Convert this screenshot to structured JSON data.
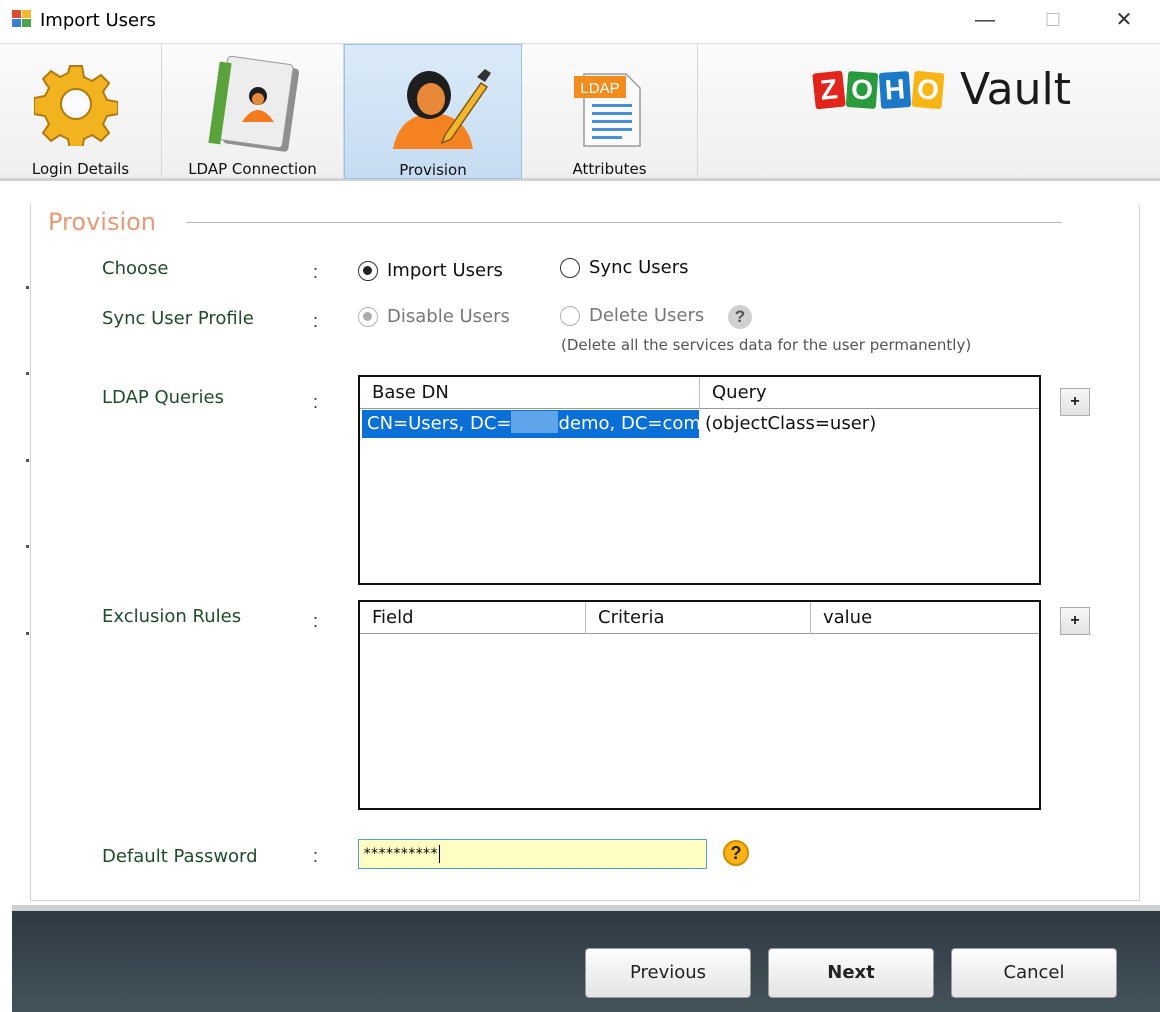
{
  "window": {
    "title": "Import Users",
    "minimize_glyph": "—",
    "maximize_glyph": "☐",
    "close_glyph": "✕"
  },
  "tabs": [
    {
      "label": "Login Details",
      "icon": "gear-icon",
      "active": false
    },
    {
      "label": "LDAP Connection",
      "icon": "address-book-icon",
      "active": false
    },
    {
      "label": "Provision",
      "icon": "user-edit-icon",
      "active": true
    },
    {
      "label": "Attributes",
      "icon": "ldap-document-icon",
      "active": false
    }
  ],
  "ldap_badge": "LDAP",
  "logo": {
    "letters": [
      "Z",
      "O",
      "H",
      "O"
    ],
    "product": "Vault",
    "colors": [
      "#e1251b",
      "#2a9b3c",
      "#1c79c7",
      "#f8b516"
    ]
  },
  "section": {
    "title": "Provision"
  },
  "form": {
    "colon": ":",
    "choose": {
      "label": "Choose",
      "options": [
        {
          "label": "Import Users",
          "checked": true
        },
        {
          "label": "Sync Users",
          "checked": false
        }
      ]
    },
    "sync_profile": {
      "label": "Sync User Profile",
      "options": [
        {
          "label": "Disable Users",
          "checked": true,
          "disabled": true
        },
        {
          "label": "Delete Users",
          "checked": false,
          "disabled": true
        }
      ],
      "help_glyph": "?",
      "note": "(Delete all the services data for the user permanently)"
    },
    "ldap_queries": {
      "label": "LDAP Queries",
      "columns": [
        "Base DN",
        "Query"
      ],
      "rows": [
        {
          "base_dn_prefix": "CN=Users, DC=",
          "base_dn_suffix": "demo, DC=com",
          "query": "(objectClass=user)"
        }
      ],
      "add_glyph": "+"
    },
    "exclusion_rules": {
      "label": "Exclusion Rules",
      "columns": [
        "Field",
        "Criteria",
        "value"
      ],
      "rows": [],
      "add_glyph": "+"
    },
    "default_password": {
      "label": "Default Password",
      "value": "**********",
      "help_glyph": "?"
    }
  },
  "buttons": {
    "previous": "Previous",
    "next": "Next",
    "cancel": "Cancel"
  }
}
